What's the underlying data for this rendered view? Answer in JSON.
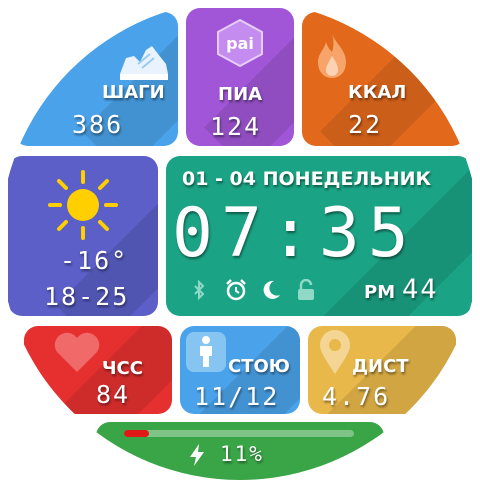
{
  "colors": {
    "steps": "#4aa3ea",
    "pai": "#a056d6",
    "kcal": "#e2691c",
    "weather": "#5b5fc7",
    "time": "#1aa384",
    "hr": "#e63030",
    "stand": "#4aa3ea",
    "dist": "#e9b84a",
    "battery": "#3aa547"
  },
  "steps": {
    "label": "ШАГИ",
    "value": "386",
    "icon": "sneaker-icon"
  },
  "pai": {
    "badge": "pai",
    "label": "ПИА",
    "value": "124",
    "icon": "pai-badge-icon"
  },
  "kcal": {
    "label": "ККАЛ",
    "value": "22",
    "icon": "flame-icon"
  },
  "weather": {
    "temp": "-16°",
    "range": "18-25",
    "icon": "sun-icon"
  },
  "clock": {
    "date": "01 - 04 ПОНЕДЕЛЬНИК",
    "time": "07:35",
    "ampm": "PM",
    "seconds": "44",
    "status_icons": [
      "bluetooth-icon",
      "alarm-icon",
      "moon-icon",
      "lock-icon"
    ]
  },
  "hr": {
    "label": "ЧСС",
    "value": "84",
    "icon": "heart-icon"
  },
  "stand": {
    "label": "СТОЮ",
    "value": "11/12",
    "icon": "standing-person-icon"
  },
  "dist": {
    "label": "ДИСТ",
    "value": "4.76",
    "icon": "location-pin-icon"
  },
  "battery": {
    "percent_text": "11%",
    "level": 0.11,
    "icon": "lightning-icon"
  }
}
